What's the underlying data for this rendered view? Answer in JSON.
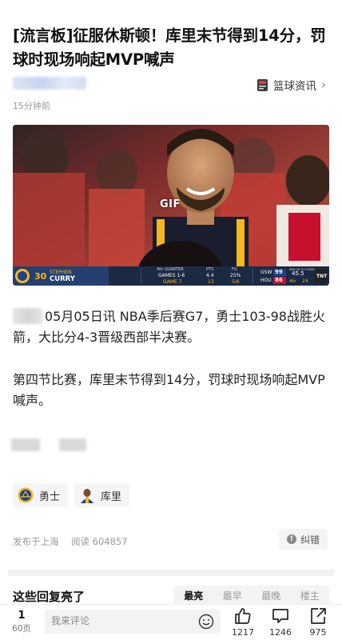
{
  "article": {
    "title": "[流言板]征服休斯顿！库里末节得到14分，罚球时现场响起MVP喊声",
    "source": "篮球资讯",
    "time": "15分钟前",
    "gif_label": "GIF",
    "paragraph1_text": "05月05日讯 NBA季后赛G7，勇士103-98战胜火箭，大比分4-3晋级西部半决赛。",
    "paragraph2": "第四节比赛，库里末节得到14分，罚球时现场响起MVP喊声。",
    "publish_location": "发布于上海",
    "reads": "阅读 604857",
    "report_label": "纠错"
  },
  "scoreboard": {
    "jersey": "30",
    "first_name": "STEPHEN",
    "last_name": "CURRY",
    "quarter": "4th QUARTER",
    "header_pts": "PTS",
    "header_fg": "FG",
    "row1_label": "GAMES 1-6",
    "row1_pts": "4.4",
    "row1_fg": "25%",
    "row2_label": "GAME 7",
    "row2_pts": "13",
    "row2_fg": "5/6",
    "team1": "GSW",
    "team1_score": "99",
    "team2": "HOU",
    "team2_score": "86",
    "clock": "45.5",
    "quarter_short": "4th",
    "shot_clock": "24",
    "network": "TNT",
    "series_note": "WIN OR GO HOME"
  },
  "tags": [
    {
      "label": "勇士",
      "icon": "warriors-logo-icon"
    },
    {
      "label": "库里",
      "icon": "player-avatar-icon"
    }
  ],
  "comments": {
    "heading": "这些回复亮了",
    "sort_tabs": [
      "最亮",
      "最早",
      "最晚",
      "楼主"
    ],
    "active_tab": "最亮"
  },
  "bottom_bar": {
    "page_number": "1",
    "page_total": "60页",
    "input_placeholder": "我来评论",
    "likes": "1217",
    "comments": "1246",
    "shares": "975"
  },
  "colors": {
    "accent_active": "#111111",
    "muted": "#999999",
    "scorebar_bg": "#1b2943",
    "warriors_gold": "#f5b81c",
    "rockets_red": "#c8102e"
  }
}
